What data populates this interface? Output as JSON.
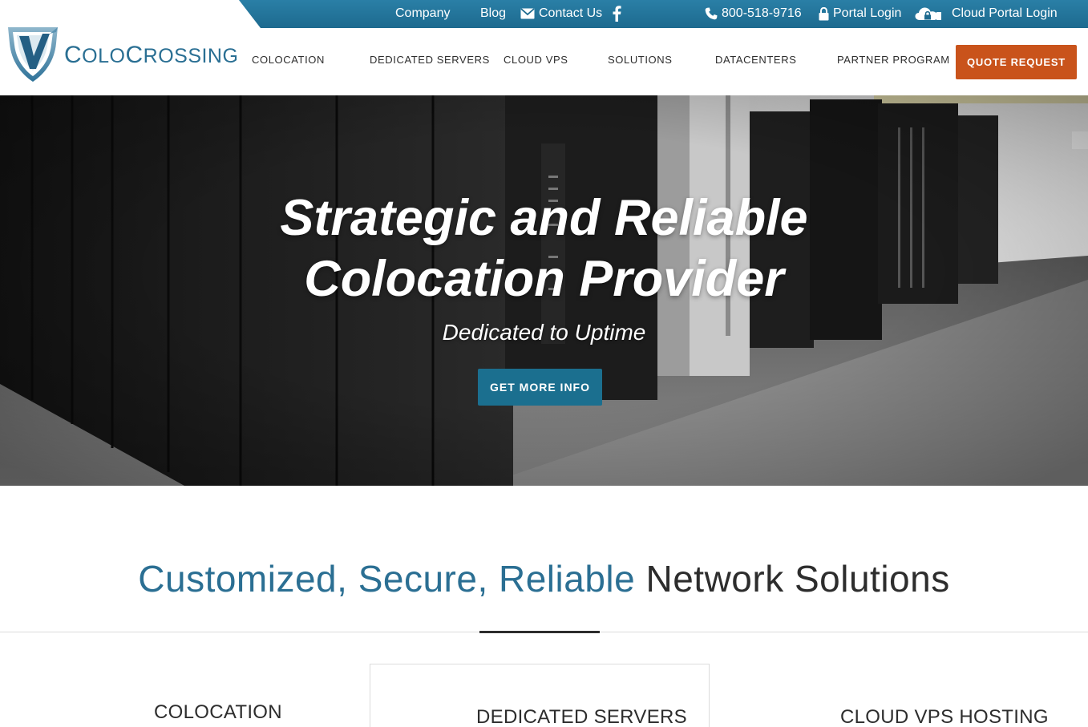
{
  "colors": {
    "brand_blue": "#1d6a8f",
    "accent_orange": "#c9531b",
    "hero_button": "#1b6f8f",
    "text_dark": "#2d2d2d"
  },
  "topbar": {
    "company": "Company",
    "blog": "Blog",
    "contact": "Contact Us",
    "phone": "800-518-9716",
    "portal_login": "Portal Login",
    "cloud_portal_login": "Cloud Portal Login",
    "icons": [
      "mail-icon",
      "facebook-icon",
      "phone-icon",
      "lock-icon",
      "cloud-lock-icon"
    ]
  },
  "logo": {
    "part1_cap": "C",
    "part1_rest": "OLO",
    "part2_cap": "C",
    "part2_rest": "ROSSING"
  },
  "nav": {
    "items": [
      "COLOCATION",
      "DEDICATED SERVERS",
      "CLOUD VPS",
      "SOLUTIONS",
      "DATACENTERS",
      "PARTNER PROGRAM"
    ],
    "quote_button": "QUOTE REQUEST"
  },
  "hero": {
    "title_line1": "Strategic and Reliable",
    "title_line2": "Colocation Provider",
    "subtitle": "Dedicated to Uptime",
    "button": "GET MORE INFO"
  },
  "section": {
    "title_accent": "Customized, Secure, Reliable",
    "title_dark": "Network Solutions"
  },
  "services": [
    "COLOCATION",
    "DEDICATED SERVERS",
    "CLOUD VPS HOSTING"
  ]
}
